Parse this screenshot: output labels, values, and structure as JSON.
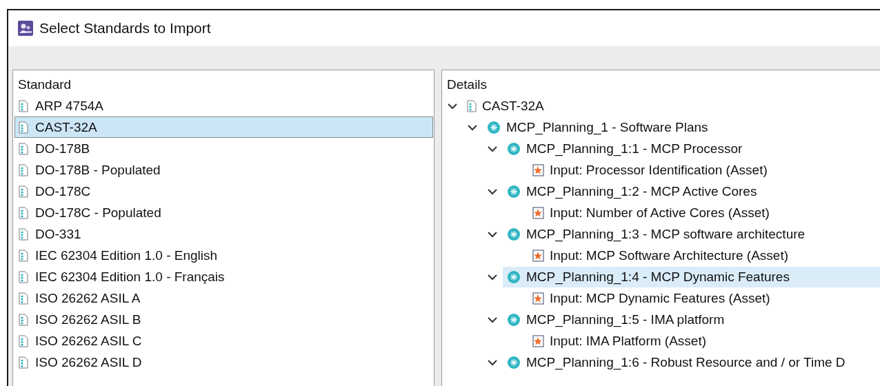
{
  "window": {
    "title": "Select Standards to Import"
  },
  "standard_panel": {
    "header": "Standard",
    "items": [
      {
        "label": "ARP 4754A",
        "selected": false
      },
      {
        "label": "CAST-32A",
        "selected": true
      },
      {
        "label": "DO-178B",
        "selected": false
      },
      {
        "label": "DO-178B - Populated",
        "selected": false
      },
      {
        "label": "DO-178C",
        "selected": false
      },
      {
        "label": "DO-178C - Populated",
        "selected": false
      },
      {
        "label": "DO-331",
        "selected": false
      },
      {
        "label": "IEC 62304 Edition 1.0 - English",
        "selected": false
      },
      {
        "label": "IEC 62304 Edition 1.0 - Français",
        "selected": false
      },
      {
        "label": "ISO 26262 ASIL A",
        "selected": false
      },
      {
        "label": "ISO 26262 ASIL B",
        "selected": false
      },
      {
        "label": "ISO 26262 ASIL C",
        "selected": false
      },
      {
        "label": "ISO 26262 ASIL D",
        "selected": false
      }
    ]
  },
  "details_panel": {
    "header": "Details",
    "tree": [
      {
        "kind": "standard",
        "label": "CAST-32A",
        "expanded": true,
        "selected": false,
        "children": [
          {
            "kind": "objective",
            "label": "MCP_Planning_1 - Software Plans",
            "expanded": true,
            "selected": false,
            "children": [
              {
                "kind": "objective",
                "label": "MCP_Planning_1:1 - MCP Processor",
                "expanded": true,
                "selected": false,
                "children": [
                  {
                    "kind": "input",
                    "label": "Input: Processor Identification (Asset)",
                    "selected": false
                  }
                ]
              },
              {
                "kind": "objective",
                "label": "MCP_Planning_1:2 - MCP Active Cores",
                "expanded": true,
                "selected": false,
                "children": [
                  {
                    "kind": "input",
                    "label": "Input: Number of Active Cores (Asset)",
                    "selected": false
                  }
                ]
              },
              {
                "kind": "objective",
                "label": "MCP_Planning_1:3 - MCP software architecture",
                "expanded": true,
                "selected": false,
                "children": [
                  {
                    "kind": "input",
                    "label": "Input: MCP Software Architecture (Asset)",
                    "selected": false
                  }
                ]
              },
              {
                "kind": "objective",
                "label": "MCP_Planning_1:4 - MCP Dynamic Features",
                "expanded": true,
                "selected": true,
                "children": [
                  {
                    "kind": "input",
                    "label": "Input: MCP Dynamic Features (Asset)",
                    "selected": false
                  }
                ]
              },
              {
                "kind": "objective",
                "label": "MCP_Planning_1:5 - IMA platform",
                "expanded": true,
                "selected": false,
                "children": [
                  {
                    "kind": "input",
                    "label": "Input: IMA Platform (Asset)",
                    "selected": false
                  }
                ]
              },
              {
                "kind": "objective",
                "label": "MCP_Planning_1:6 - Robust Resource and / or Time D",
                "expanded": true,
                "selected": false
              }
            ]
          }
        ]
      }
    ]
  }
}
